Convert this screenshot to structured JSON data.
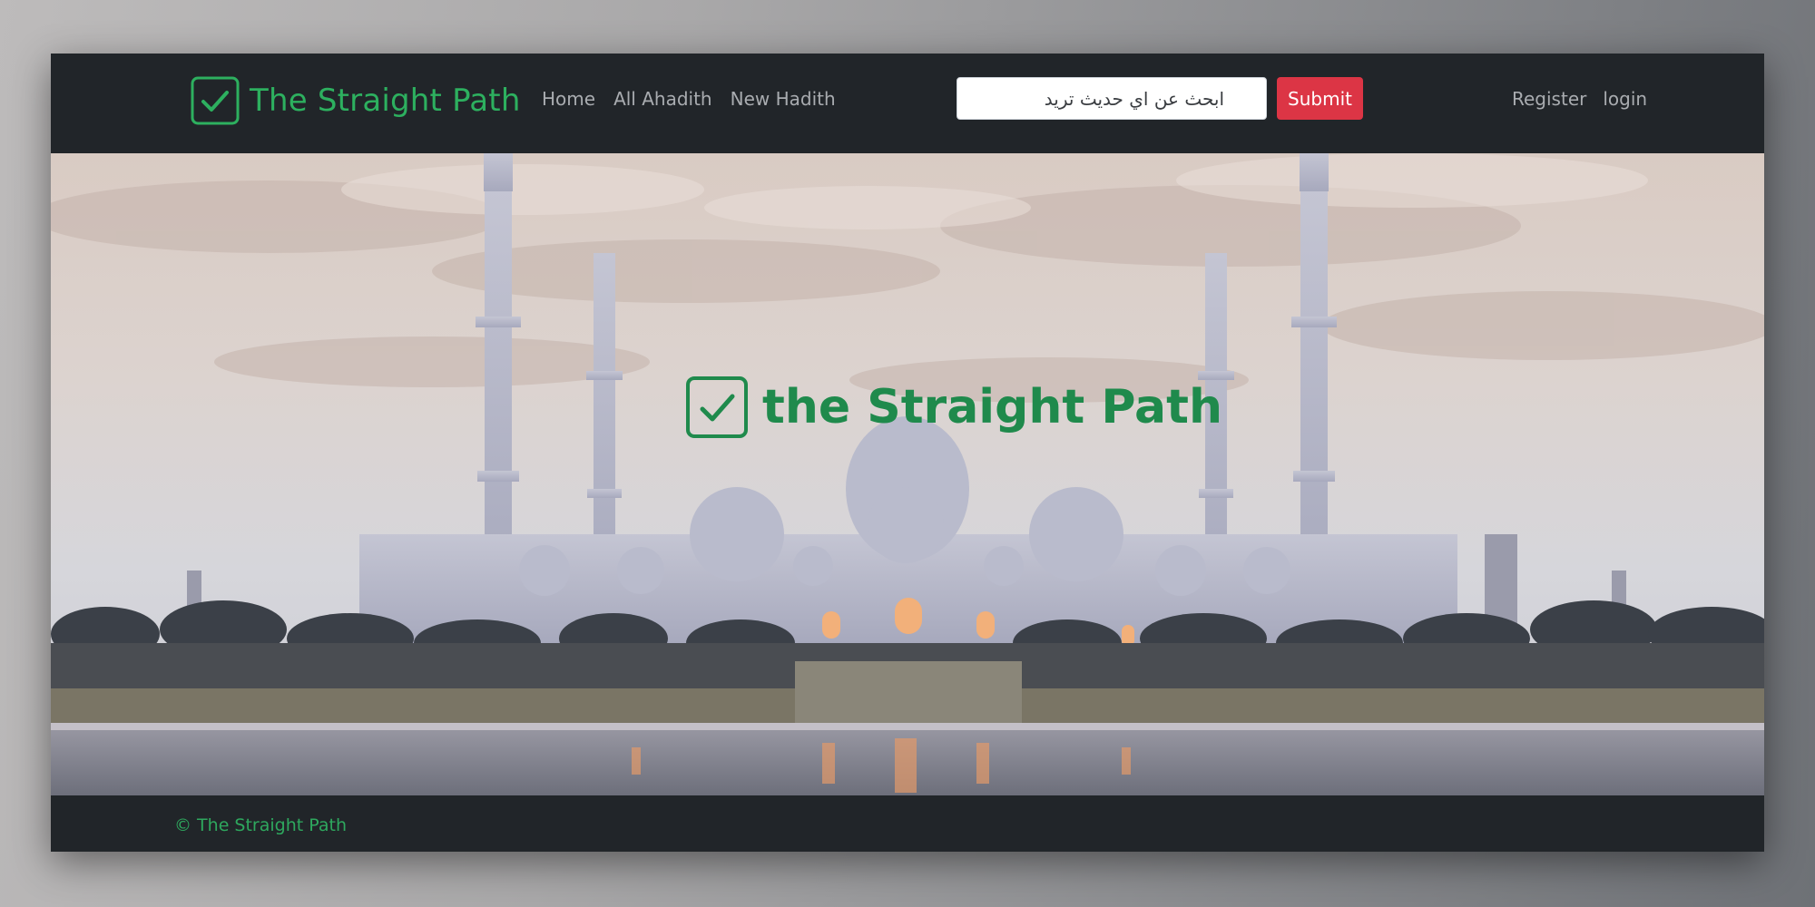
{
  "navbar": {
    "brand": "The Straight Path",
    "brand_icon": "check-square-icon",
    "links": [
      "Home",
      "All Ahadith",
      "New Hadith"
    ],
    "search": {
      "placeholder": "ابحث عن اي حديث تريد"
    },
    "submit_label": "Submit",
    "auth": {
      "register": "Register",
      "login": "login"
    }
  },
  "hero": {
    "title": "the Straight Path",
    "icon": "check-square-icon"
  },
  "footer": {
    "copyright": "© The Straight Path"
  },
  "colors": {
    "navbar_bg": "#212529",
    "brand_green": "#2db05f",
    "hero_green": "#1f8a4c",
    "submit_red": "#dc3545",
    "nav_link": "#a9acb0"
  }
}
